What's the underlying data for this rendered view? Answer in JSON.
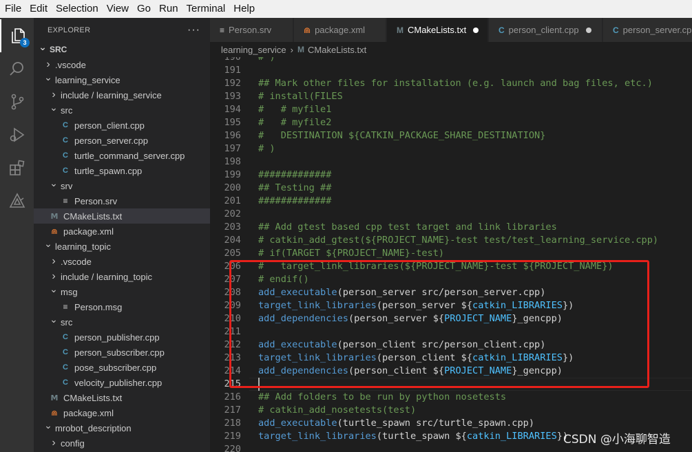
{
  "menu": [
    "File",
    "Edit",
    "Selection",
    "View",
    "Go",
    "Run",
    "Terminal",
    "Help"
  ],
  "activity": {
    "badge": "3",
    "items": [
      "explorer-icon",
      "search-icon",
      "source-control-icon",
      "run-debug-icon",
      "extensions-icon",
      "ros-icon"
    ]
  },
  "sidebar": {
    "title": "EXPLORER",
    "more": "···",
    "tree": [
      {
        "label": "SRC",
        "depth": 0,
        "chev": "v",
        "icon": "",
        "bold": true
      },
      {
        "label": ".vscode",
        "depth": 1,
        "chev": ">",
        "icon": ""
      },
      {
        "label": "learning_service",
        "depth": 1,
        "chev": "v",
        "icon": ""
      },
      {
        "label": "include / learning_service",
        "depth": 2,
        "chev": ">",
        "icon": ""
      },
      {
        "label": "src",
        "depth": 2,
        "chev": "v",
        "icon": ""
      },
      {
        "label": "person_client.cpp",
        "depth": 3,
        "chev": "",
        "icon": "cpp"
      },
      {
        "label": "person_server.cpp",
        "depth": 3,
        "chev": "",
        "icon": "cpp"
      },
      {
        "label": "turtle_command_server.cpp",
        "depth": 3,
        "chev": "",
        "icon": "cpp"
      },
      {
        "label": "turtle_spawn.cpp",
        "depth": 3,
        "chev": "",
        "icon": "cpp"
      },
      {
        "label": "srv",
        "depth": 2,
        "chev": "v",
        "icon": ""
      },
      {
        "label": "Person.srv",
        "depth": 3,
        "chev": "",
        "icon": "srv"
      },
      {
        "label": "CMakeLists.txt",
        "depth": 2,
        "chev": "",
        "icon": "cmake",
        "selected": true
      },
      {
        "label": "package.xml",
        "depth": 2,
        "chev": "",
        "icon": "xml"
      },
      {
        "label": "learning_topic",
        "depth": 1,
        "chev": "v",
        "icon": ""
      },
      {
        "label": ".vscode",
        "depth": 2,
        "chev": ">",
        "icon": ""
      },
      {
        "label": "include / learning_topic",
        "depth": 2,
        "chev": ">",
        "icon": ""
      },
      {
        "label": "msg",
        "depth": 2,
        "chev": "v",
        "icon": ""
      },
      {
        "label": "Person.msg",
        "depth": 3,
        "chev": "",
        "icon": "srv"
      },
      {
        "label": "src",
        "depth": 2,
        "chev": "v",
        "icon": ""
      },
      {
        "label": "person_publisher.cpp",
        "depth": 3,
        "chev": "",
        "icon": "cpp"
      },
      {
        "label": "person_subscriber.cpp",
        "depth": 3,
        "chev": "",
        "icon": "cpp"
      },
      {
        "label": "pose_subscriber.cpp",
        "depth": 3,
        "chev": "",
        "icon": "cpp"
      },
      {
        "label": "velocity_publisher.cpp",
        "depth": 3,
        "chev": "",
        "icon": "cpp"
      },
      {
        "label": "CMakeLists.txt",
        "depth": 2,
        "chev": "",
        "icon": "cmake"
      },
      {
        "label": "package.xml",
        "depth": 2,
        "chev": "",
        "icon": "xml"
      },
      {
        "label": "mrobot_description",
        "depth": 1,
        "chev": "v",
        "icon": ""
      },
      {
        "label": "config",
        "depth": 2,
        "chev": ">",
        "icon": ""
      }
    ]
  },
  "tabs": [
    {
      "label": "Person.srv",
      "icon": "srv",
      "active": false,
      "dirty": false
    },
    {
      "label": "package.xml",
      "icon": "xml",
      "active": false,
      "dirty": false
    },
    {
      "label": "CMakeLists.txt",
      "icon": "cmake",
      "active": true,
      "dirty": true
    },
    {
      "label": "person_client.cpp",
      "icon": "cpp",
      "active": false,
      "dirty": true
    },
    {
      "label": "person_server.cpp",
      "icon": "cpp",
      "active": false,
      "dirty": false
    }
  ],
  "breadcrumb": [
    "learning_service",
    "CMakeLists.txt"
  ],
  "editor": {
    "current_line": "215",
    "lines": [
      {
        "n": "190",
        "tokens": [
          [
            "c",
            "# )"
          ]
        ]
      },
      {
        "n": "191",
        "tokens": []
      },
      {
        "n": "192",
        "tokens": [
          [
            "c",
            "## Mark other files for installation (e.g. launch and bag files, etc.)"
          ]
        ]
      },
      {
        "n": "193",
        "tokens": [
          [
            "c",
            "# install(FILES"
          ]
        ]
      },
      {
        "n": "194",
        "tokens": [
          [
            "c",
            "#   # myfile1"
          ]
        ]
      },
      {
        "n": "195",
        "tokens": [
          [
            "c",
            "#   # myfile2"
          ]
        ]
      },
      {
        "n": "196",
        "tokens": [
          [
            "c",
            "#   DESTINATION ${CATKIN_PACKAGE_SHARE_DESTINATION}"
          ]
        ]
      },
      {
        "n": "197",
        "tokens": [
          [
            "c",
            "# )"
          ]
        ]
      },
      {
        "n": "198",
        "tokens": []
      },
      {
        "n": "199",
        "tokens": [
          [
            "c",
            "#############"
          ]
        ]
      },
      {
        "n": "200",
        "tokens": [
          [
            "c",
            "## Testing ##"
          ]
        ]
      },
      {
        "n": "201",
        "tokens": [
          [
            "c",
            "#############"
          ]
        ]
      },
      {
        "n": "202",
        "tokens": []
      },
      {
        "n": "203",
        "tokens": [
          [
            "c",
            "## Add gtest based cpp test target and link libraries"
          ]
        ]
      },
      {
        "n": "204",
        "tokens": [
          [
            "c",
            "# catkin_add_gtest(${PROJECT_NAME}-test test/test_learning_service.cpp)"
          ]
        ]
      },
      {
        "n": "205",
        "tokens": [
          [
            "c",
            "# if(TARGET ${PROJECT_NAME}-test)"
          ]
        ]
      },
      {
        "n": "206",
        "tokens": [
          [
            "c",
            "#   target_link_libraries(${PROJECT_NAME}-test ${PROJECT_NAME})"
          ]
        ]
      },
      {
        "n": "207",
        "tokens": [
          [
            "c",
            "# endif()"
          ]
        ]
      },
      {
        "n": "208",
        "tokens": [
          [
            "f",
            "add_executable"
          ],
          [
            "d",
            "(person_server src/person_server.cpp)"
          ]
        ]
      },
      {
        "n": "209",
        "tokens": [
          [
            "f",
            "target_link_libraries"
          ],
          [
            "d",
            "(person_server ${"
          ],
          [
            "v",
            "catkin_LIBRARIES"
          ],
          [
            "d",
            "})"
          ]
        ]
      },
      {
        "n": "210",
        "tokens": [
          [
            "f",
            "add_dependencies"
          ],
          [
            "d",
            "(person_server ${"
          ],
          [
            "v",
            "PROJECT_NAME"
          ],
          [
            "d",
            "}_gencpp)"
          ]
        ]
      },
      {
        "n": "211",
        "tokens": []
      },
      {
        "n": "212",
        "tokens": [
          [
            "f",
            "add_executable"
          ],
          [
            "d",
            "(person_client src/person_client.cpp)"
          ]
        ]
      },
      {
        "n": "213",
        "tokens": [
          [
            "f",
            "target_link_libraries"
          ],
          [
            "d",
            "(person_client ${"
          ],
          [
            "v",
            "catkin_LIBRARIES"
          ],
          [
            "d",
            "})"
          ]
        ]
      },
      {
        "n": "214",
        "tokens": [
          [
            "f",
            "add_dependencies"
          ],
          [
            "d",
            "(person_client ${"
          ],
          [
            "v",
            "PROJECT_NAME"
          ],
          [
            "d",
            "}_gencpp)"
          ]
        ]
      },
      {
        "n": "215",
        "tokens": []
      },
      {
        "n": "216",
        "tokens": [
          [
            "c",
            "## Add folders to be run by python nosetests"
          ]
        ]
      },
      {
        "n": "217",
        "tokens": [
          [
            "c",
            "# catkin_add_nosetests(test)"
          ]
        ]
      },
      {
        "n": "218",
        "tokens": [
          [
            "f",
            "add_executable"
          ],
          [
            "d",
            "(turtle_spawn src/turtle_spawn.cpp)"
          ]
        ]
      },
      {
        "n": "219",
        "tokens": [
          [
            "f",
            "target_link_libraries"
          ],
          [
            "d",
            "(turtle_spawn ${"
          ],
          [
            "v",
            "catkin_LIBRARIES"
          ],
          [
            "d",
            "})"
          ]
        ]
      },
      {
        "n": "220",
        "tokens": []
      }
    ]
  },
  "colors": {
    "highlight_box": "#e8201a",
    "accent": "#0e70c0"
  },
  "watermark": "CSDN @小海聊智造"
}
